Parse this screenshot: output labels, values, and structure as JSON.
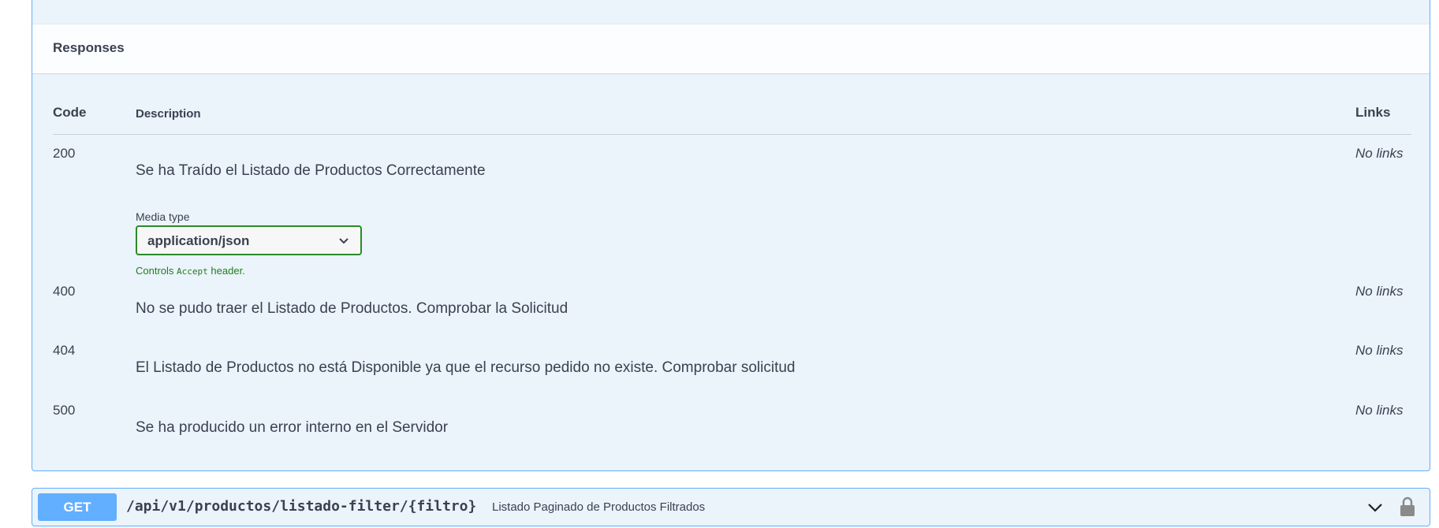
{
  "responses": {
    "title": "Responses",
    "columns": {
      "code": "Code",
      "description": "Description",
      "links": "Links"
    },
    "rows": [
      {
        "code": "200",
        "description": "Se ha Traído el Listado de Productos Correctamente",
        "links": "No links",
        "media_type_label": "Media type",
        "media_type_value": "application/json",
        "controls_prefix": "Controls",
        "controls_code": "Accept",
        "controls_suffix": "header."
      },
      {
        "code": "400",
        "description": "No se pudo traer el Listado de Productos. Comprobar la Solicitud",
        "links": "No links"
      },
      {
        "code": "404",
        "description": "El Listado de Productos no está Disponible ya que el recurso pedido no existe. Comprobar solicitud",
        "links": "No links"
      },
      {
        "code": "500",
        "description": "Se ha producido un error interno en el Servidor",
        "links": "No links"
      }
    ]
  },
  "next_operation": {
    "method": "GET",
    "path": "/api/v1/productos/listado-filter/{filtro}",
    "summary": "Listado Paginado de Productos Filtrados",
    "icons": [
      "chevron-down-icon",
      "lock-icon"
    ]
  },
  "colors": {
    "get_accent": "#61affe",
    "get_background": "#ebf3fb",
    "media_border": "#2b8a2b"
  }
}
